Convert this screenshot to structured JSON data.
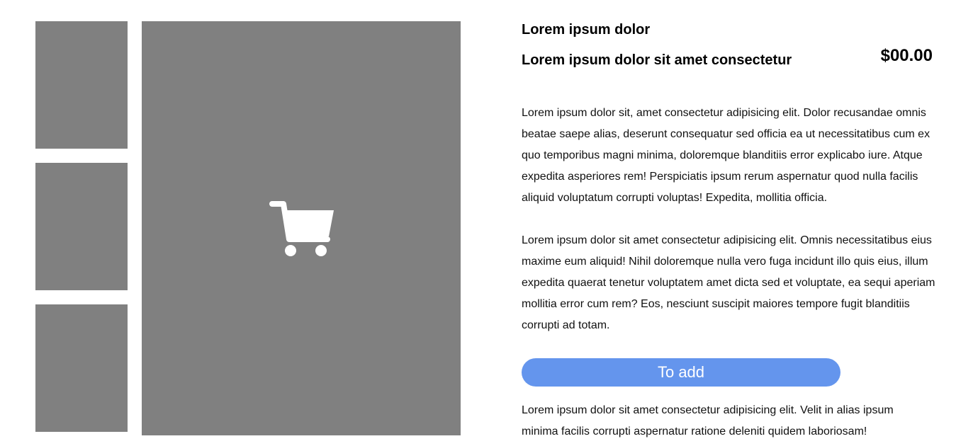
{
  "gallery": {
    "thumbnail_count": 3,
    "main_icon": "shopping-cart-icon",
    "placeholder_color": "#808080"
  },
  "product": {
    "name": "Lorem ipsum dolor",
    "subtitle": "Lorem ipsum dolor sit amet consectetur",
    "price": "$00.00",
    "description_1": "Lorem ipsum dolor sit, amet consectetur adipisicing elit. Dolor recusandae omnis beatae saepe alias, deserunt consequatur sed officia ea ut necessitatibus cum ex quo temporibus magni minima, doloremque blanditiis error explicabo iure. Atque expedita asperiores rem! Perspiciatis ipsum rerum aspernatur quod nulla facilis aliquid voluptatum corrupti voluptas! Expedita, mollitia officia.",
    "description_2": "Lorem ipsum dolor sit amet consectetur adipisicing elit. Omnis necessitatibus eius maxime eum aliquid! Nihil doloremque nulla vero fuga incidunt illo quis eius, illum expedita quaerat tenetur voluptatem amet dicta sed et voluptate, ea sequi aperiam mollitia error cum rem? Eos, nesciunt suscipit maiores tempore fugit blanditiis corrupti ad totam.",
    "add_button_label": "To add",
    "footnote": "Lorem ipsum dolor sit amet consectetur adipisicing elit. Velit in alias ipsum minima facilis corrupti aspernatur ratione deleniti quidem laboriosam!"
  },
  "colors": {
    "button": "#6495ed",
    "button_text": "#ffffff",
    "image_placeholder": "#808080"
  }
}
